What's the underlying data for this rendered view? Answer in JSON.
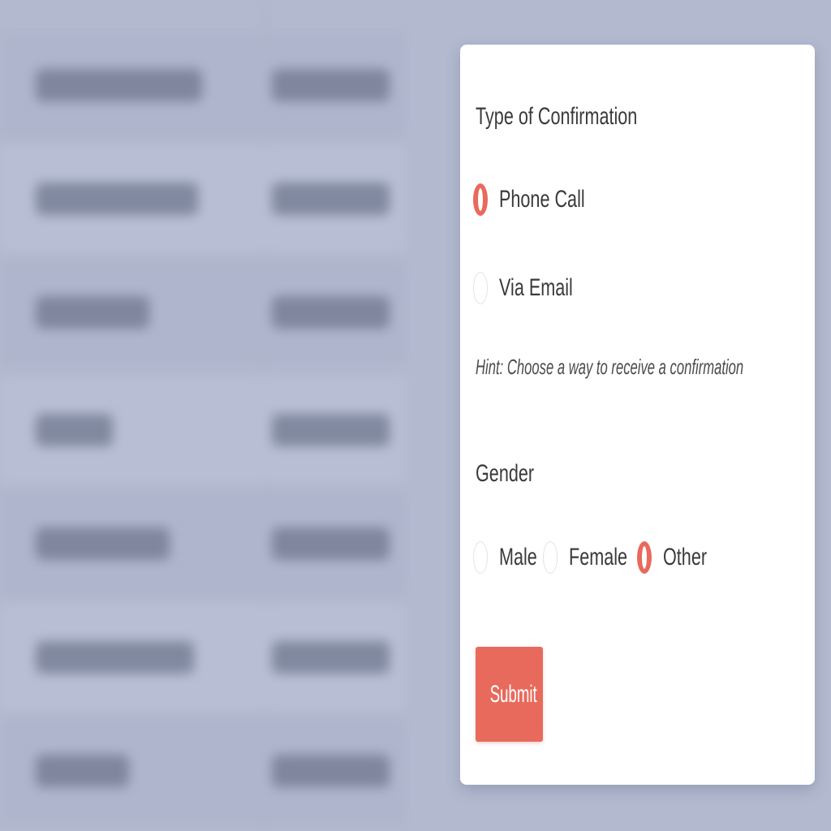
{
  "form": {
    "confirmation": {
      "label": "Type of Confirmation",
      "options": [
        {
          "label": "Phone Call",
          "checked": true
        },
        {
          "label": "Via Email",
          "checked": false
        }
      ],
      "hint": "Hint: Choose a way to receive a confirmation"
    },
    "gender": {
      "label": "Gender",
      "options": [
        {
          "label": "Male",
          "checked": false
        },
        {
          "label": "Female",
          "checked": false
        },
        {
          "label": "Other",
          "checked": true
        }
      ]
    },
    "submit_label": "Submit"
  },
  "colors": {
    "accent": "#e86a5c",
    "background": "#b3bad0",
    "card": "#ffffff"
  }
}
